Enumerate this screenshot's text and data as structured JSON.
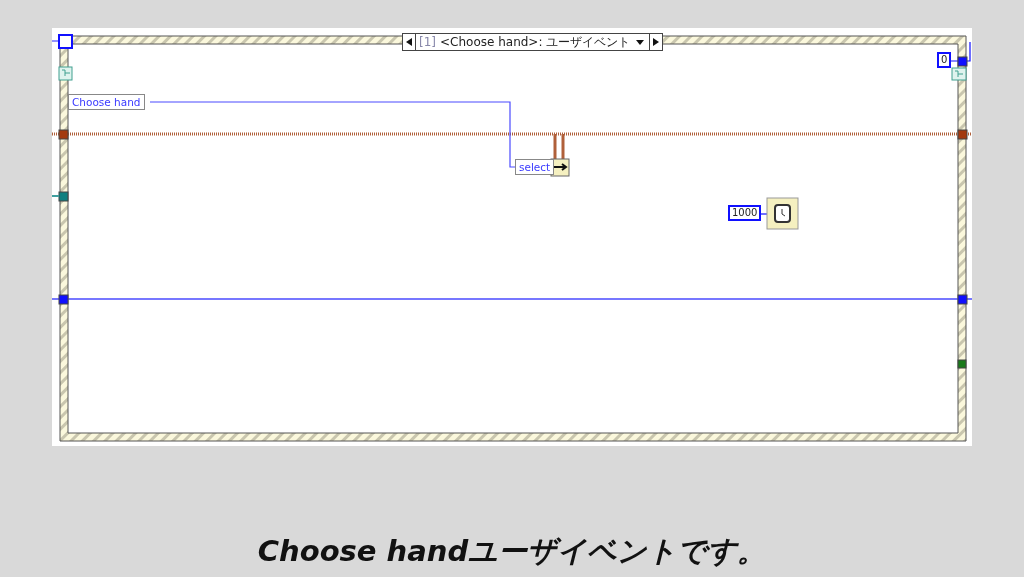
{
  "diagram": {
    "case_selector": {
      "index": "[1]",
      "label": "<Choose hand>: ユーザイベント"
    },
    "nodes": [
      {
        "kind": "reference",
        "label": "Choose hand"
      },
      {
        "kind": "property",
        "label": "select"
      }
    ],
    "constants": [
      {
        "kind": "wait",
        "value": "1000"
      },
      {
        "kind": "timeout",
        "value": "0"
      }
    ]
  },
  "caption": "Choose handユーザイベントです。"
}
